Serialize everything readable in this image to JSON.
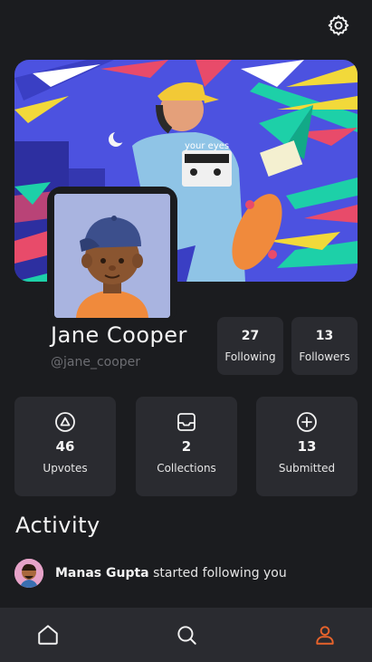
{
  "header": {
    "settings_icon": "gear-icon"
  },
  "profile": {
    "name": "Jane Cooper",
    "handle": "@jane_cooper",
    "cover_text": "your eyes"
  },
  "social_stats": [
    {
      "value": "27",
      "label": "Following"
    },
    {
      "value": "13",
      "label": "Followers"
    }
  ],
  "content_stats": [
    {
      "icon": "triangle-circle-icon",
      "value": "46",
      "label": "Upvotes"
    },
    {
      "icon": "inbox-icon",
      "value": "2",
      "label": "Collections"
    },
    {
      "icon": "plus-circle-icon",
      "value": "13",
      "label": "Submitted"
    }
  ],
  "activity": {
    "title": "Activity",
    "items": [
      {
        "actor": "Manas Gupta",
        "action": "started following you"
      }
    ]
  },
  "bottom_nav": {
    "items": [
      {
        "icon": "home-icon",
        "active": false
      },
      {
        "icon": "search-icon",
        "active": false
      },
      {
        "icon": "profile-icon",
        "active": true
      }
    ],
    "active_color": "#e8632b",
    "inactive_color": "#f2f2f2"
  },
  "colors": {
    "background": "#1b1c1f",
    "surface": "#2a2b30",
    "muted_text": "#6c6d72",
    "accent": "#e8632b"
  }
}
